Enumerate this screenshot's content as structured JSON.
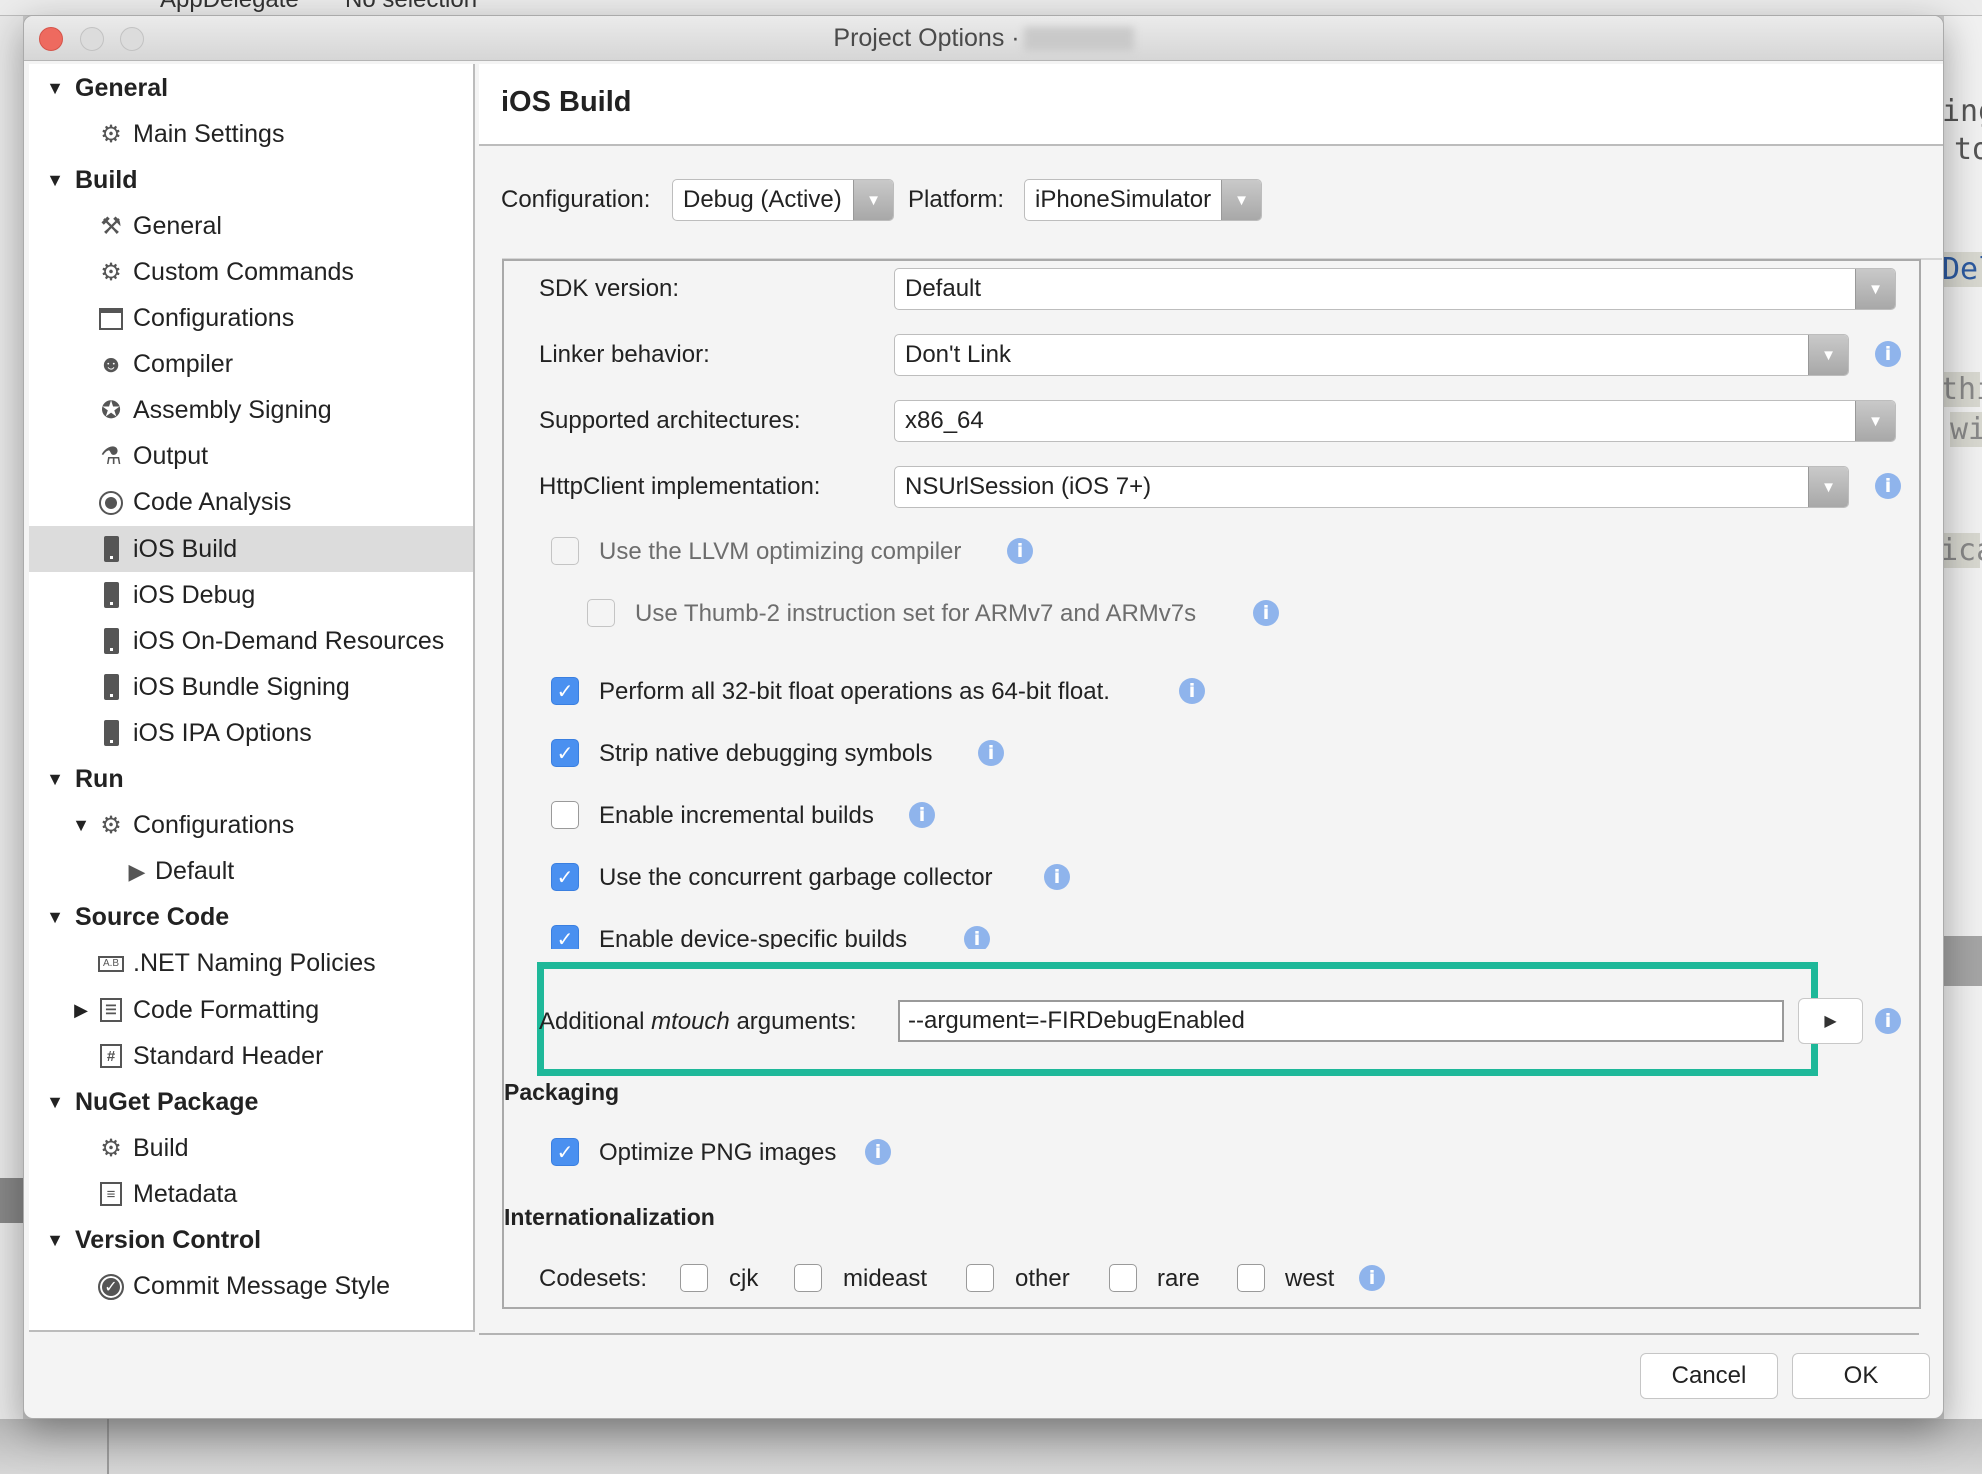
{
  "background": {
    "top_crumbs": [
      "AppDelegate",
      "No selection"
    ],
    "code_fragments": [
      "ing",
      "to",
      "Del",
      "thi",
      "wi",
      "ica"
    ]
  },
  "window": {
    "title": "Project Options ·"
  },
  "sidebar": {
    "items": [
      {
        "label": "General",
        "type": "group",
        "expanded": true
      },
      {
        "label": "Main Settings",
        "icon": "gear-icon"
      },
      {
        "label": "Build",
        "type": "group",
        "expanded": true
      },
      {
        "label": "General",
        "icon": "hammer-icon"
      },
      {
        "label": "Custom Commands",
        "icon": "gear-icon"
      },
      {
        "label": "Configurations",
        "icon": "window-icon"
      },
      {
        "label": "Compiler",
        "icon": "robot-icon"
      },
      {
        "label": "Assembly Signing",
        "icon": "badge-icon"
      },
      {
        "label": "Output",
        "icon": "flask-icon"
      },
      {
        "label": "Code Analysis",
        "icon": "radio-icon"
      },
      {
        "label": "iOS Build",
        "icon": "phone-icon",
        "selected": true
      },
      {
        "label": "iOS Debug",
        "icon": "phone-icon"
      },
      {
        "label": "iOS On-Demand Resources",
        "icon": "phone-icon"
      },
      {
        "label": "iOS Bundle Signing",
        "icon": "phone-icon"
      },
      {
        "label": "iOS IPA Options",
        "icon": "phone-icon"
      },
      {
        "label": "Run",
        "type": "group",
        "expanded": true
      },
      {
        "label": "Configurations",
        "icon": "gear-icon",
        "expanded": true
      },
      {
        "label": "Default",
        "icon": "play-icon"
      },
      {
        "label": "Source Code",
        "type": "group",
        "expanded": true
      },
      {
        "label": ".NET Naming Policies",
        "icon": "naming-icon"
      },
      {
        "label": "Code Formatting",
        "icon": "format-icon",
        "expanded": false
      },
      {
        "label": "Standard Header",
        "icon": "hash-icon"
      },
      {
        "label": "NuGet Package",
        "type": "group",
        "expanded": true
      },
      {
        "label": "Build",
        "icon": "gear-icon"
      },
      {
        "label": "Metadata",
        "icon": "document-icon"
      },
      {
        "label": "Version Control",
        "type": "group",
        "expanded": true
      },
      {
        "label": "Commit Message Style",
        "icon": "check-circle-icon"
      }
    ],
    "icon_glyphs": {
      "naming": "A.B",
      "hash": "#",
      "check": "✓",
      "gear": "⚙",
      "hammer": "⚒",
      "robot": "☻",
      "badge": "✪",
      "flask": "⚗",
      "play": "▶",
      "format": "☰",
      "doc": "≡"
    }
  },
  "main": {
    "title": "iOS Build",
    "configuration_label": "Configuration:",
    "configuration_value": "Debug (Active)",
    "platform_label": "Platform:",
    "platform_value": "iPhoneSimulator",
    "fields": [
      {
        "label": "SDK version:",
        "value": "Default",
        "info": false
      },
      {
        "label": "Linker behavior:",
        "value": "Don't Link",
        "info": true
      },
      {
        "label": "Supported architectures:",
        "value": "x86_64",
        "info": false
      },
      {
        "label": "HttpClient implementation:",
        "value": "NSUrlSession (iOS 7+)",
        "info": true
      }
    ],
    "checkboxes": [
      {
        "label": "Use the LLVM optimizing compiler",
        "checked": false,
        "disabled": true
      },
      {
        "label": "Use Thumb-2 instruction set for ARMv7 and ARMv7s",
        "checked": false,
        "disabled": true
      },
      {
        "label": "Perform all 32-bit float operations as 64-bit float.",
        "checked": true
      },
      {
        "label": "Strip native debugging symbols",
        "checked": true
      },
      {
        "label": "Enable incremental builds",
        "checked": false
      },
      {
        "label": "Use the concurrent garbage collector",
        "checked": true
      },
      {
        "label": "Enable device-specific builds",
        "checked": true
      }
    ],
    "mtouch": {
      "label_prefix": "Additional ",
      "label_italic": "mtouch",
      "label_suffix": " arguments:",
      "value": "--argument=-FIRDebugEnabled"
    },
    "packaging": {
      "heading": "Packaging",
      "optimize_png_label": "Optimize PNG images",
      "optimize_png_checked": true
    },
    "internationalization": {
      "heading": "Internationalization",
      "codesets_label": "Codesets:",
      "codesets": [
        {
          "label": "cjk",
          "checked": false
        },
        {
          "label": "mideast",
          "checked": false
        },
        {
          "label": "other",
          "checked": false
        },
        {
          "label": "rare",
          "checked": false
        },
        {
          "label": "west",
          "checked": false
        }
      ]
    },
    "info_glyph": "i",
    "check_glyph": "✓",
    "arrow_glyph": "▼",
    "run_glyph": "▶"
  },
  "footer": {
    "cancel_label": "Cancel",
    "ok_label": "OK"
  },
  "colors": {
    "highlight": "#1eb899",
    "checkbox_checked": "#4a90f0",
    "info": "#8fb4ec"
  }
}
